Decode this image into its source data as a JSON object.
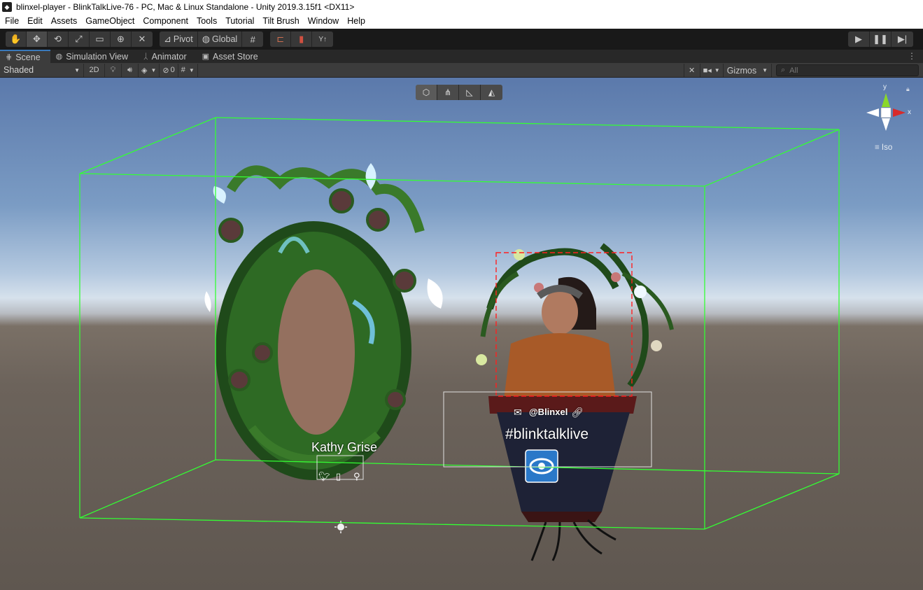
{
  "window": {
    "title": "blinxel-player - BlinkTalkLive-76 - PC, Mac & Linux Standalone - Unity 2019.3.15f1 <DX11>"
  },
  "menu": [
    "File",
    "Edit",
    "Assets",
    "GameObject",
    "Component",
    "Tools",
    "Tutorial",
    "Tilt Brush",
    "Window",
    "Help"
  ],
  "toolbar": {
    "pivot_label": "Pivot",
    "global_label": "Global"
  },
  "tabs": [
    {
      "label": "Scene",
      "icon": "grid-icon"
    },
    {
      "label": "Simulation View",
      "icon": "globe-icon"
    },
    {
      "label": "Animator",
      "icon": "animator-icon"
    },
    {
      "label": "Asset Store",
      "icon": "bag-icon"
    }
  ],
  "scene_toolbar": {
    "draw_mode": "Shaded",
    "mode_2d": "2D",
    "hidden_count": "0",
    "gizmos_label": "Gizmos",
    "search_placeholder": "All"
  },
  "viewport": {
    "projection_label": "Iso",
    "axis_x": "x",
    "axis_y": "y",
    "overlay": {
      "name_left": "Kathy Grise",
      "handle_right": "@Blinxel",
      "hashtag": "#blinktalklive"
    }
  },
  "colors": {
    "selection_box": "#33ff33",
    "selection_dashed": "#ff2020",
    "accent_tab": "#3a79bb",
    "eye_button": "#2a78c8"
  }
}
